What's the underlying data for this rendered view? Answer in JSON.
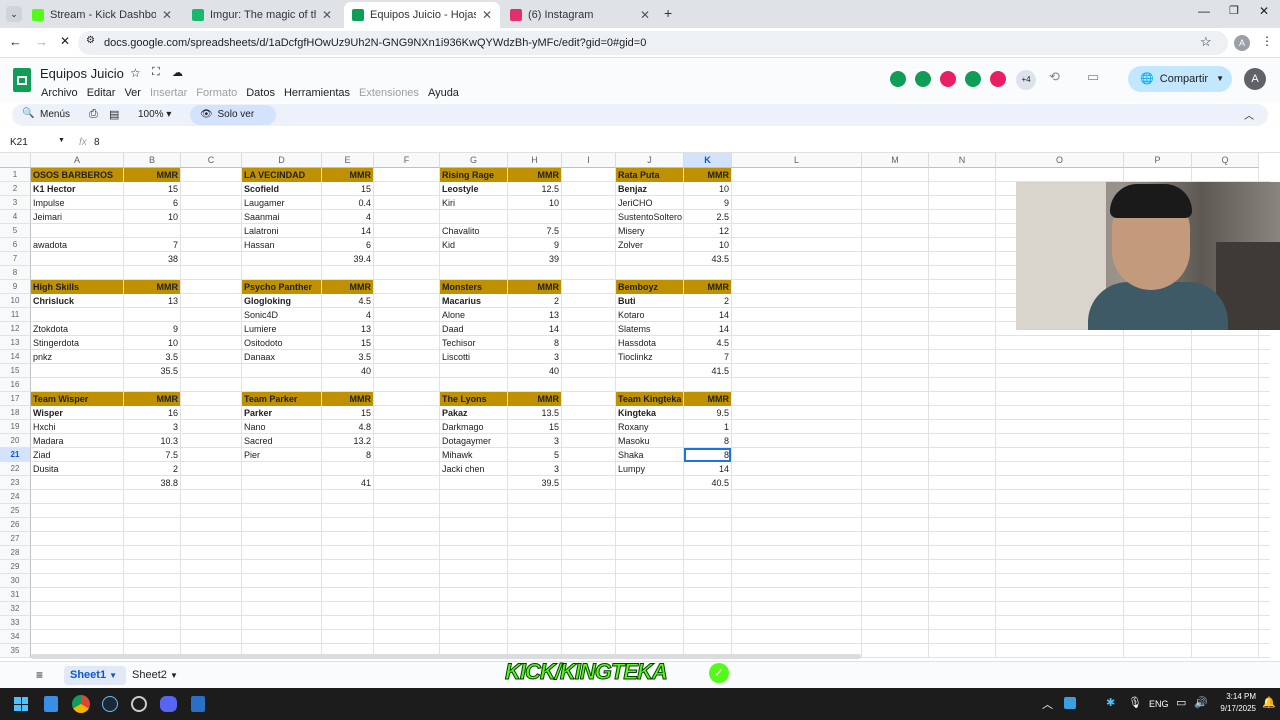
{
  "browser": {
    "tabs": [
      {
        "title": "Stream - Kick Dashboard",
        "color": "#53fc18"
      },
      {
        "title": "Imgur: The magic of the Interne",
        "color": "#1bb76e"
      },
      {
        "title": "Equipos Juicio - Hojas de cálcul",
        "color": "#0f9d58"
      },
      {
        "title": "(6) Instagram",
        "color": "#e1306c"
      }
    ],
    "url": "docs.google.com/spreadsheets/d/1aDcfgfHOwUz9Uh2N-GNG9NXn1i936KwQYWdzBh-yMFc/edit?gid=0#gid=0",
    "profile": "A"
  },
  "doc": {
    "title": "Equipos Juicio",
    "menus": [
      {
        "label": "Archivo",
        "disabled": false
      },
      {
        "label": "Editar",
        "disabled": false
      },
      {
        "label": "Ver",
        "disabled": false
      },
      {
        "label": "Insertar",
        "disabled": true
      },
      {
        "label": "Formato",
        "disabled": true
      },
      {
        "label": "Datos",
        "disabled": false
      },
      {
        "label": "Herramientas",
        "disabled": false
      },
      {
        "label": "Extensiones",
        "disabled": true
      },
      {
        "label": "Ayuda",
        "disabled": false
      }
    ],
    "collaborators_more": "+4",
    "share_label": "Compartir",
    "profile": "A"
  },
  "toolbar": {
    "search": "Menús",
    "zoom": "100%",
    "mode": "Solo ver"
  },
  "formula_bar": {
    "cell_ref": "K21",
    "fx": "fx",
    "value": "8"
  },
  "columns": [
    {
      "label": "A",
      "w": 93
    },
    {
      "label": "B",
      "w": 57
    },
    {
      "label": "C",
      "w": 61
    },
    {
      "label": "D",
      "w": 80
    },
    {
      "label": "E",
      "w": 52
    },
    {
      "label": "F",
      "w": 66
    },
    {
      "label": "G",
      "w": 68
    },
    {
      "label": "H",
      "w": 54
    },
    {
      "label": "I",
      "w": 54
    },
    {
      "label": "J",
      "w": 68
    },
    {
      "label": "K",
      "w": 48
    },
    {
      "label": "L",
      "w": 130
    },
    {
      "label": "M",
      "w": 67
    },
    {
      "label": "N",
      "w": 67
    },
    {
      "label": "O",
      "w": 128
    },
    {
      "label": "P",
      "w": 68
    },
    {
      "label": "Q",
      "w": 67
    }
  ],
  "row_count": 35,
  "header_label": "MMR",
  "teams": [
    {
      "name": "OSOS BARBEROS",
      "col": 0,
      "row": 1,
      "players": [
        [
          "K1 Hector",
          "15"
        ],
        [
          "Impulse",
          "6"
        ],
        [
          "Jeimari",
          "10"
        ],
        [
          "",
          ""
        ],
        [
          "awadota",
          "7"
        ]
      ],
      "total": "38"
    },
    {
      "name": "LA VECINDAD",
      "col": 3,
      "row": 1,
      "players": [
        [
          "Scofield",
          "15"
        ],
        [
          "Laugamer",
          "0.4"
        ],
        [
          "Saanmai",
          "4"
        ],
        [
          "Lalatroni",
          "14"
        ],
        [
          "Hassan",
          "6"
        ]
      ],
      "total": "39.4"
    },
    {
      "name": "Rising Rage",
      "col": 6,
      "row": 1,
      "players": [
        [
          "Leostyle",
          "12.5"
        ],
        [
          "Kiri",
          "10"
        ],
        [
          "",
          ""
        ],
        [
          "Chavalito",
          "7.5"
        ],
        [
          "Kid",
          "9"
        ]
      ],
      "total": "39"
    },
    {
      "name": "Rata Puta",
      "col": 9,
      "row": 1,
      "players": [
        [
          "Benjaz",
          "10"
        ],
        [
          "JeriCHO",
          "9"
        ],
        [
          "SustentoSoltero",
          "2.5"
        ],
        [
          "Misery",
          "12"
        ],
        [
          "Zolver",
          "10"
        ]
      ],
      "total": "43.5"
    },
    {
      "name": "High Skills",
      "col": 0,
      "row": 9,
      "players": [
        [
          "Chrisluck",
          "13"
        ],
        [
          "",
          ""
        ],
        [
          "Ztokdota",
          "9"
        ],
        [
          "Stingerdota",
          "10"
        ],
        [
          "pnkz",
          "3.5"
        ]
      ],
      "total": "35.5"
    },
    {
      "name": "Psycho Panther",
      "col": 3,
      "row": 9,
      "players": [
        [
          "Glogloking",
          "4.5"
        ],
        [
          "Sonic4D",
          "4"
        ],
        [
          "Lumiere",
          "13"
        ],
        [
          "Ositodoto",
          "15"
        ],
        [
          "Danaax",
          "3.5"
        ]
      ],
      "total": "40"
    },
    {
      "name": "Monsters",
      "col": 6,
      "row": 9,
      "players": [
        [
          "Macarius",
          "2"
        ],
        [
          "Alone",
          "13"
        ],
        [
          "Daad",
          "14"
        ],
        [
          "Techisor",
          "8"
        ],
        [
          "Liscotti",
          "3"
        ]
      ],
      "total": "40"
    },
    {
      "name": "Bemboyz",
      "col": 9,
      "row": 9,
      "players": [
        [
          "Buti",
          "2"
        ],
        [
          "Kotaro",
          "14"
        ],
        [
          "Slatems",
          "14"
        ],
        [
          "Hassdota",
          "4.5"
        ],
        [
          "Tioclinkz",
          "7"
        ]
      ],
      "total": "41.5"
    },
    {
      "name": "Team Wisper",
      "col": 0,
      "row": 17,
      "players": [
        [
          "Wisper",
          "16"
        ],
        [
          "Hxchi",
          "3"
        ],
        [
          "Madara",
          "10.3"
        ],
        [
          "Ziad",
          "7.5"
        ],
        [
          "Dusita",
          "2"
        ]
      ],
      "total": "38.8"
    },
    {
      "name": "Team Parker",
      "col": 3,
      "row": 17,
      "players": [
        [
          "Parker",
          "15"
        ],
        [
          "Nano",
          "4.8"
        ],
        [
          "Sacred",
          "13.2"
        ],
        [
          "Pier",
          "8"
        ],
        [
          "",
          ""
        ]
      ],
      "total": "41"
    },
    {
      "name": "The Lyons",
      "col": 6,
      "row": 17,
      "players": [
        [
          "Pakaz",
          "13.5"
        ],
        [
          "Darkmago",
          "15"
        ],
        [
          "Dotagaymer",
          "3"
        ],
        [
          "Mihawk",
          "5"
        ],
        [
          "Jacki chen",
          "3"
        ]
      ],
      "total": "39.5"
    },
    {
      "name": "Team Kingteka",
      "col": 9,
      "row": 17,
      "players": [
        [
          "Kingteka",
          "9.5"
        ],
        [
          "Roxany",
          "1"
        ],
        [
          "Masoku",
          "8"
        ],
        [
          "Shaka",
          "8"
        ],
        [
          "Lumpy",
          "14"
        ]
      ],
      "total": "40.5"
    }
  ],
  "sheets": [
    "Sheet1",
    "Sheet2"
  ],
  "overlay_text": "KICK/KINGTEKA",
  "taskbar": {
    "lang": "ENG",
    "time": "3:14 PM",
    "date": "9/17/2025"
  },
  "colors": {
    "team_header": "#bf9000",
    "accent": "#0b57d0"
  }
}
